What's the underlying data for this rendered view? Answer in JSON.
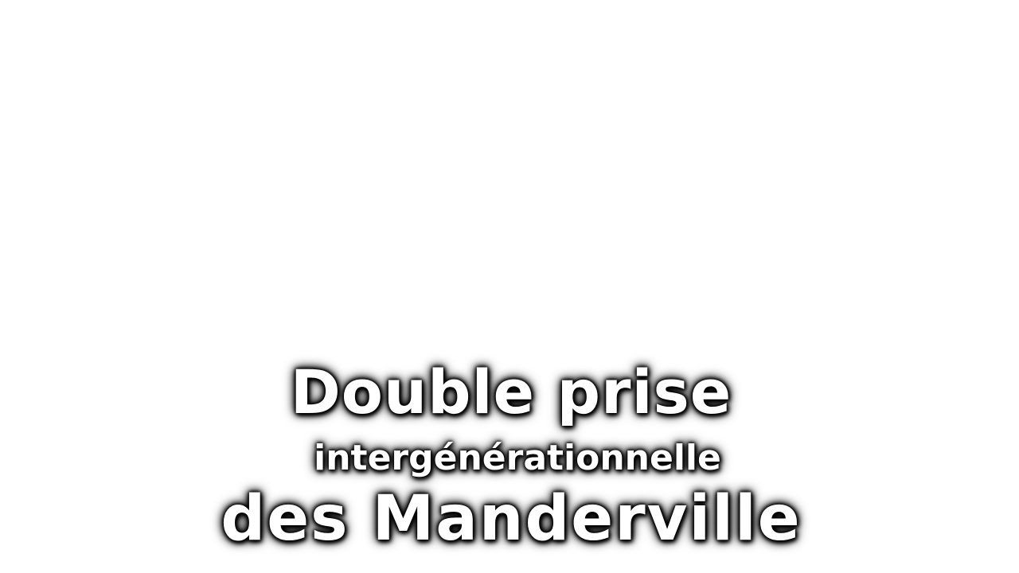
{
  "title": {
    "line1": "Double prise",
    "line2": "intergénérationnelle",
    "line3": "des Manderville"
  },
  "colors": {
    "background": "#ffffff",
    "text": "#ffffff",
    "outline": "#000000"
  }
}
